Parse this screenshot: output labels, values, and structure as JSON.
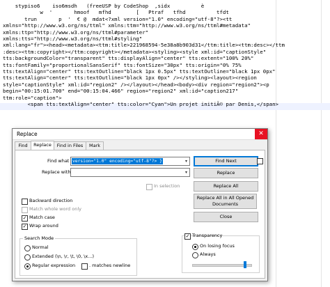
{
  "editor": {
    "lines": [
      "    stypiso6    iso6msdh   (freeUSP by CodeShop  ,sidx          è",
      "            w  '       hmoof   mfhd        [   Ptraf   tfhd          tfdt",
      "       trun       p  '  € @  mdat<?xml version=\"1.0\" encoding=\"utf-8\"?><tt",
      "xmlns=\"http://www.w3.org/ns/ttml\" xmlns:ttm=\"http://www.w3.org/ns/ttml#metadata\"",
      "xmlns:ttp=\"http://www.w3.org/ns/ttml#parameter\"",
      "xmlns:tts=\"http://www.w3.org/ns/ttml#styling\"",
      "xml:lang=\"fr\"><head><metadata><ttm:title>221968594-5e38a8b903d31</ttm:title><ttm:desc></ttm",
      ":desc><ttm:copyright></ttm:copyright></metadata><styling><style xml:id=\"captionStyle\"",
      "tts:backgroundColor=\"transparent\" tts:displayAlign=\"center\" tts:extent=\"100% 20%\"",
      "tts:fontFamily=\"proportionalSansSerif\" tts:fontSize=\"30px\" tts:origin=\"0% 75%",
      "tts:textAlign=\"center\" tts:textOutline=\"black 1px 0.5px\" tts:textOutline=\"black 1px 0px\"",
      "tts:textAlign=\"center\" tts:textOutline=\"black 1px 0px\" /></styling><layout><region",
      "style=\"captionStyle\" xml:id=\"region2\" /></layout></head><body><div region=\"region2\"><p",
      "begin=\"00:15:01.700\" end=\"00:15:04.466\" region=\"region2\" xml:id=\"caption217\"",
      "ttm:role=\"caption\">",
      "        <span tts:textAlign=\"center\" tts:color=\"Cyan\">Un projet initiÃ© par Denis,</span>"
    ]
  },
  "dialog": {
    "title": "Replace",
    "close_glyph": "✕",
    "tabs": [
      "Find",
      "Replace",
      "Find in Files",
      "Mark"
    ],
    "find_what_label": "Find what :",
    "find_what_value": "version=\"1.0\" encoding=\"utf-8\"?> }",
    "replace_with_label": "Replace with :",
    "replace_with_value": "",
    "in_selection_label": "In selection",
    "buttons": {
      "find_next": "Find Next",
      "replace": "Replace",
      "replace_all": "Replace All",
      "replace_all_opened_line1": "Replace All in All Opened",
      "replace_all_opened_line2": "Documents",
      "close": "Close"
    },
    "options": {
      "backward": "Backward direction",
      "whole_word": "Match whole word only",
      "match_case": "Match case",
      "wrap_around": "Wrap around"
    },
    "search_mode": {
      "title": "Search Mode",
      "normal": "Normal",
      "extended": "Extended (\\n, \\r, \\t, \\0, \\x...)",
      "regex": "Regular expression",
      "dot_newline": ". matches newline"
    },
    "transparency": {
      "label": "Transparency",
      "on_losing_focus": "On losing focus",
      "always": "Always",
      "level": 0.9
    },
    "check": "✓",
    "arrow": "▾"
  }
}
